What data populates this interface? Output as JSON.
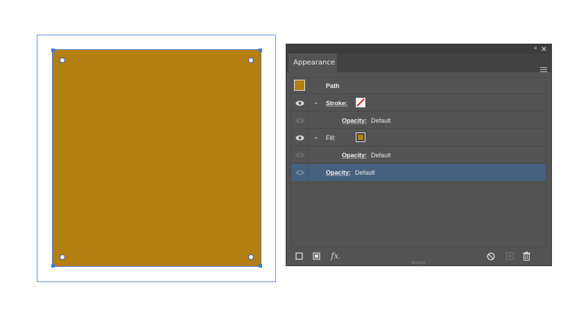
{
  "canvas": {
    "fill_color": "#b37f10",
    "selection_color": "#3f76e6"
  },
  "panel": {
    "tab_label": "Appearance",
    "collapse_glyph": "«",
    "close_glyph": "×",
    "rows": {
      "path": {
        "label": "Path",
        "swatch_color": "#b37f10"
      },
      "stroke": {
        "label": "Stroke:"
      },
      "stroke_opacity": {
        "label": "Opacity:",
        "value": "Default"
      },
      "fill": {
        "label": "Fill:",
        "swatch_color": "#b37f10"
      },
      "fill_opacity": {
        "label": "Opacity:",
        "value": "Default"
      },
      "object_opacity": {
        "label": "Opacity:",
        "value": "Default"
      }
    },
    "footer": {
      "fx_label": "fx"
    },
    "colors": {
      "panel_bg": "#535353",
      "selected_row": "#46607f"
    }
  }
}
